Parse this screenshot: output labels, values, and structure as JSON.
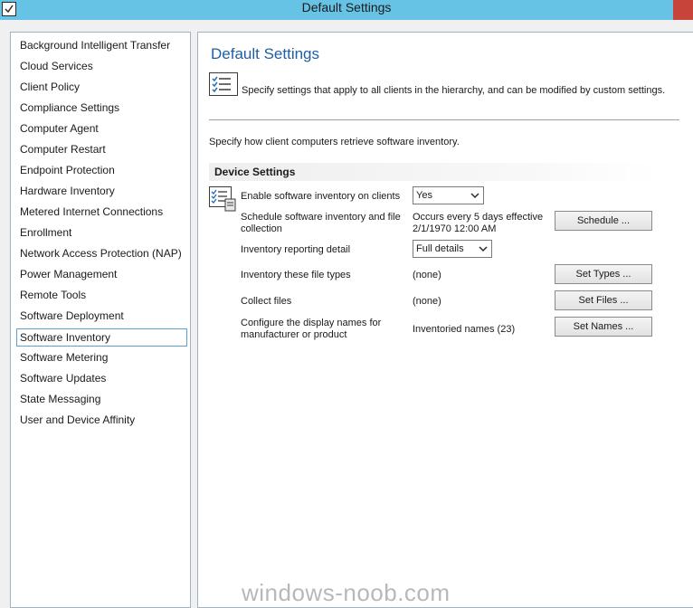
{
  "window": {
    "title": "Default Settings"
  },
  "nav": {
    "items": [
      {
        "label": "Background Intelligent Transfer"
      },
      {
        "label": "Cloud Services"
      },
      {
        "label": "Client Policy"
      },
      {
        "label": "Compliance Settings"
      },
      {
        "label": "Computer Agent"
      },
      {
        "label": "Computer Restart"
      },
      {
        "label": "Endpoint Protection"
      },
      {
        "label": "Hardware Inventory"
      },
      {
        "label": "Metered Internet Connections"
      },
      {
        "label": "Enrollment"
      },
      {
        "label": "Network Access Protection (NAP)"
      },
      {
        "label": "Power Management"
      },
      {
        "label": "Remote Tools"
      },
      {
        "label": "Software Deployment"
      },
      {
        "label": "Software Inventory",
        "selected": true
      },
      {
        "label": "Software Metering"
      },
      {
        "label": "Software Updates"
      },
      {
        "label": "State Messaging"
      },
      {
        "label": "User and Device Affinity"
      }
    ]
  },
  "main": {
    "title": "Default Settings",
    "description": "Specify settings that apply to all clients in the hierarchy, and can be modified by custom settings.",
    "subdescription": "Specify how client computers retrieve software inventory.",
    "section_title": "Device Settings",
    "rows": {
      "enable": {
        "label": "Enable software inventory on clients",
        "value": "Yes"
      },
      "schedule": {
        "label_line1": "Schedule software inventory and file",
        "label_line2": "collection",
        "value_line1": "Occurs every 5 days effective",
        "value_line2": "2/1/1970 12:00 AM",
        "button": "Schedule ..."
      },
      "detail": {
        "label": "Inventory reporting detail",
        "value": "Full details"
      },
      "file_types": {
        "label": "Inventory these file types",
        "value": "(none)",
        "button": "Set Types ..."
      },
      "collect": {
        "label": "Collect files",
        "value": "(none)",
        "button": "Set Files ..."
      },
      "names": {
        "label_line1": "Configure the display names for",
        "label_line2": "manufacturer or product",
        "value": "Inventoried names (23)",
        "button": "Set Names ..."
      }
    }
  },
  "watermark": "windows-noob.com",
  "colors": {
    "titlebar": "#66c3e6",
    "title_text": "#1e5fa8",
    "selection_border": "#5aa0d4",
    "close_button": "#c7443a"
  }
}
